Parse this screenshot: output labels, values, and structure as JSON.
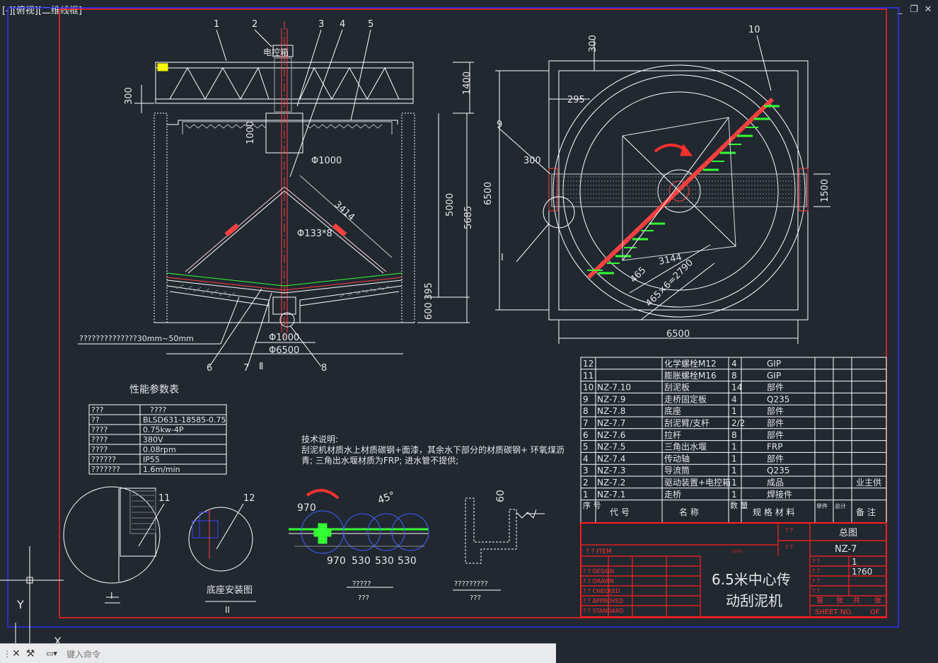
{
  "viewport": {
    "label": "[-][俯视][二维线框]"
  },
  "window_controls": {
    "min": "_",
    "restore": "❐",
    "close": "✕"
  },
  "drawing": {
    "section_view": {
      "callouts": [
        "1",
        "2",
        "3",
        "4",
        "5",
        "6",
        "7",
        "8"
      ],
      "control_box": "电控箱",
      "dims": {
        "d300": "300",
        "d1400": "1400",
        "d1000": "1000",
        "phi1000_top": "Φ1000",
        "d3414": "3414",
        "phi133": "Φ133*8",
        "d5000": "5000",
        "d5685": "5685",
        "d600": "600",
        "d395": "395",
        "phi1000_bot": "Φ1000",
        "phi6500": "Φ6500",
        "detail_mark": "Ⅱ"
      },
      "note_left": "??????????????30mm~50mm"
    },
    "plan_view": {
      "callouts": [
        "10",
        "9",
        "I"
      ],
      "dims": {
        "d300_top": "300",
        "d295": "295",
        "d300_left": "300",
        "d6500_v": "6500",
        "d1500": "1500",
        "d3144": "3144",
        "d465": "465",
        "d465x6": "465×6=2790",
        "d6500_h": "6500"
      }
    },
    "perf_table": {
      "title": "性能参数表",
      "rows": [
        [
          "???",
          "????"
        ],
        [
          "??",
          "BLSD631-18585-0.75"
        ],
        [
          "????",
          "0.75kw-4P"
        ],
        [
          "????",
          "380V"
        ],
        [
          "????",
          "0.08rpm"
        ],
        [
          "??????",
          "IP55"
        ],
        [
          "???????",
          "1.6m/min"
        ]
      ]
    },
    "tech_notes": {
      "title": "技术说明:",
      "line1": "刮泥机材质水上材质碳钢+面漆，其余水下部分的材质碳钢+ 环氧煤沥",
      "line2": "青; 三角出水堰材质为FRP; 进水管不提供;"
    },
    "details": {
      "d_I": {
        "callout": "11",
        "label": "I"
      },
      "d_II": {
        "callout": "12",
        "title": "底座安装图",
        "label": "II"
      },
      "d_scraper": {
        "dims": [
          "970",
          "45°",
          "970",
          "530",
          "530",
          "530"
        ],
        "caption1": "?????",
        "caption2": "???"
      },
      "d_weir": {
        "dim": "60",
        "caption1": "?????????",
        "caption2": "???"
      }
    },
    "bom": {
      "rows": [
        {
          "no": "12",
          "code": "",
          "name": "化学螺栓M12",
          "qty": "4",
          "material": "GIP",
          "note": ""
        },
        {
          "no": "11",
          "code": "",
          "name": "膨胀螺栓M16",
          "qty": "8",
          "material": "GIP",
          "note": ""
        },
        {
          "no": "10",
          "code": "NZ-7.10",
          "name": "刮泥板",
          "qty": "14",
          "material": "部件",
          "note": ""
        },
        {
          "no": "9",
          "code": "NZ-7.9",
          "name": "走桥固定板",
          "qty": "4",
          "material": "Q235",
          "note": ""
        },
        {
          "no": "8",
          "code": "NZ-7.8",
          "name": "底座",
          "qty": "1",
          "material": "部件",
          "note": ""
        },
        {
          "no": "7",
          "code": "NZ-7.7",
          "name": "刮泥臂/支杆",
          "qty": "2/2",
          "material": "部件",
          "note": ""
        },
        {
          "no": "6",
          "code": "NZ-7.6",
          "name": "拉杆",
          "qty": "8",
          "material": "部件",
          "note": ""
        },
        {
          "no": "5",
          "code": "NZ-7.5",
          "name": "三角出水堰",
          "qty": "1",
          "material": "FRP",
          "note": ""
        },
        {
          "no": "4",
          "code": "NZ-7.4",
          "name": "传动轴",
          "qty": "1",
          "material": "部件",
          "note": ""
        },
        {
          "no": "3",
          "code": "NZ-7.3",
          "name": "导流筒",
          "qty": "1",
          "material": "Q235",
          "note": ""
        },
        {
          "no": "2",
          "code": "NZ-7.2",
          "name": "驱动装置+电控箱",
          "qty": "1",
          "material": "成品",
          "note": "业主供"
        },
        {
          "no": "1",
          "code": "NZ-7.1",
          "name": "走桥",
          "qty": "1",
          "material": "焊接件",
          "note": ""
        }
      ],
      "header": {
        "no": "序\n号",
        "code": "代    号",
        "name": "名    称",
        "qty": "数\n量",
        "material": "规 格 材 料",
        "single": "单件",
        "total": "总计",
        "note": "备    注"
      }
    },
    "title_block": {
      "material_lbl": "? ?",
      "drawing_name": "总图",
      "item_lbl": "?  ?  ITEM",
      "item_mark": "?????",
      "subject_lbl": "? ?",
      "drawing_no": "NZ-7",
      "design": "?  ?  DESIGN",
      "drawn": "?  ?  DRAWN",
      "checked": "?  ?  CHECKED",
      "approved": "?  ?  APPROVED",
      "standard": "?  ?  STANDARD",
      "amount_lbl": "? ?",
      "amount": "1",
      "scale_lbl": "? ?",
      "scale": "1?60",
      "weight_lbl": "? ?",
      "code_lbl": "? ?",
      "title_line1": "6.5米中心传",
      "title_line2": "动刮泥机",
      "sheet_a": "第",
      "sheet_b": "张",
      "sheet_c": "共",
      "sheet_d": "张",
      "sheet_no": "SHEET  NO.",
      "sheet_of": "OF"
    },
    "ucs": {
      "y": "Y",
      "x": "X"
    }
  },
  "command_line": {
    "placeholder": "键入命令"
  },
  "colors": {
    "bg": "#212830",
    "frame": "#ff2020",
    "blue": "#3030ff",
    "line": "#ffffff",
    "green": "#33ff33",
    "yellow": "#ffff00",
    "magenta": "#ff40ff"
  }
}
